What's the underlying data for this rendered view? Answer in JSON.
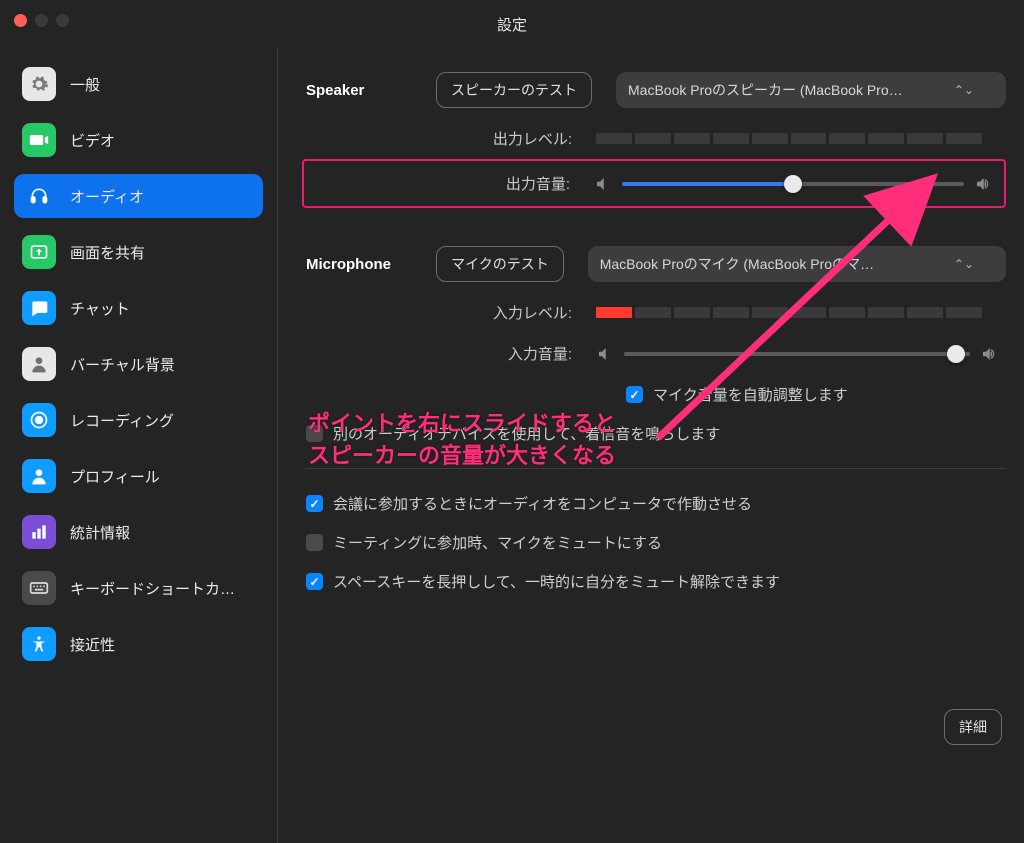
{
  "window": {
    "title": "設定"
  },
  "sidebar": {
    "items": [
      {
        "label": "一般",
        "icon": "gear",
        "bg": "#e7e7e9",
        "fg": "#6f6f72"
      },
      {
        "label": "ビデオ",
        "icon": "video",
        "bg": "#27c868",
        "fg": "#ffffff"
      },
      {
        "label": "オーディオ",
        "icon": "headset",
        "bg": "transparent",
        "fg": "#ffffff",
        "active": true
      },
      {
        "label": "画面を共有",
        "icon": "share",
        "bg": "#27c868",
        "fg": "#ffffff"
      },
      {
        "label": "チャット",
        "icon": "chat",
        "bg": "#0e9cff",
        "fg": "#ffffff"
      },
      {
        "label": "バーチャル背景",
        "icon": "person",
        "bg": "#e7e7e9",
        "fg": "#6f6f72"
      },
      {
        "label": "レコーディング",
        "icon": "record",
        "bg": "#0e9cff",
        "fg": "#ffffff"
      },
      {
        "label": "プロフィール",
        "icon": "profile",
        "bg": "#0e9cff",
        "fg": "#ffffff"
      },
      {
        "label": "統計情報",
        "icon": "stats",
        "bg": "#7a4fd6",
        "fg": "#ffffff"
      },
      {
        "label": "キーボードショートカ…",
        "icon": "keyboard",
        "bg": "#4a4a4c",
        "fg": "#dcdcdc"
      },
      {
        "label": "接近性",
        "icon": "access",
        "bg": "#0e9cff",
        "fg": "#ffffff"
      }
    ]
  },
  "speaker": {
    "title": "Speaker",
    "test_btn": "スピーカーのテスト",
    "device": "MacBook Proのスピーカー (MacBook Pro…",
    "output_level_label": "出力レベル:",
    "output_volume_label": "出力音量:",
    "output_volume_pct": 50,
    "output_level_segments_on": 0
  },
  "mic": {
    "title": "Microphone",
    "test_btn": "マイクのテスト",
    "device": "MacBook Proのマイク (MacBook Proのマ…",
    "input_level_label": "入力レベル:",
    "input_volume_label": "入力音量:",
    "input_volume_pct": 96,
    "input_level_segments_on": 1,
    "auto_adjust": {
      "checked": true,
      "label": "マイク音量を自動調整します"
    }
  },
  "options": {
    "ring_device": {
      "checked": false,
      "label": "別のオーディオデバイスを使用して、着信音を鳴らします"
    },
    "auto_join": {
      "checked": true,
      "label": "会議に参加するときにオーディオをコンピュータで作動させる"
    },
    "mute_on_join": {
      "checked": false,
      "label": "ミーティングに参加時、マイクをミュートにする"
    },
    "push_to_talk": {
      "checked": true,
      "label": "スペースキーを長押しして、一時的に自分をミュート解除できます"
    }
  },
  "details_btn": "詳細",
  "annotation": {
    "line1": "ポイントを右にスライドすると",
    "line2": "スピーカーの音量が大きくなる"
  }
}
